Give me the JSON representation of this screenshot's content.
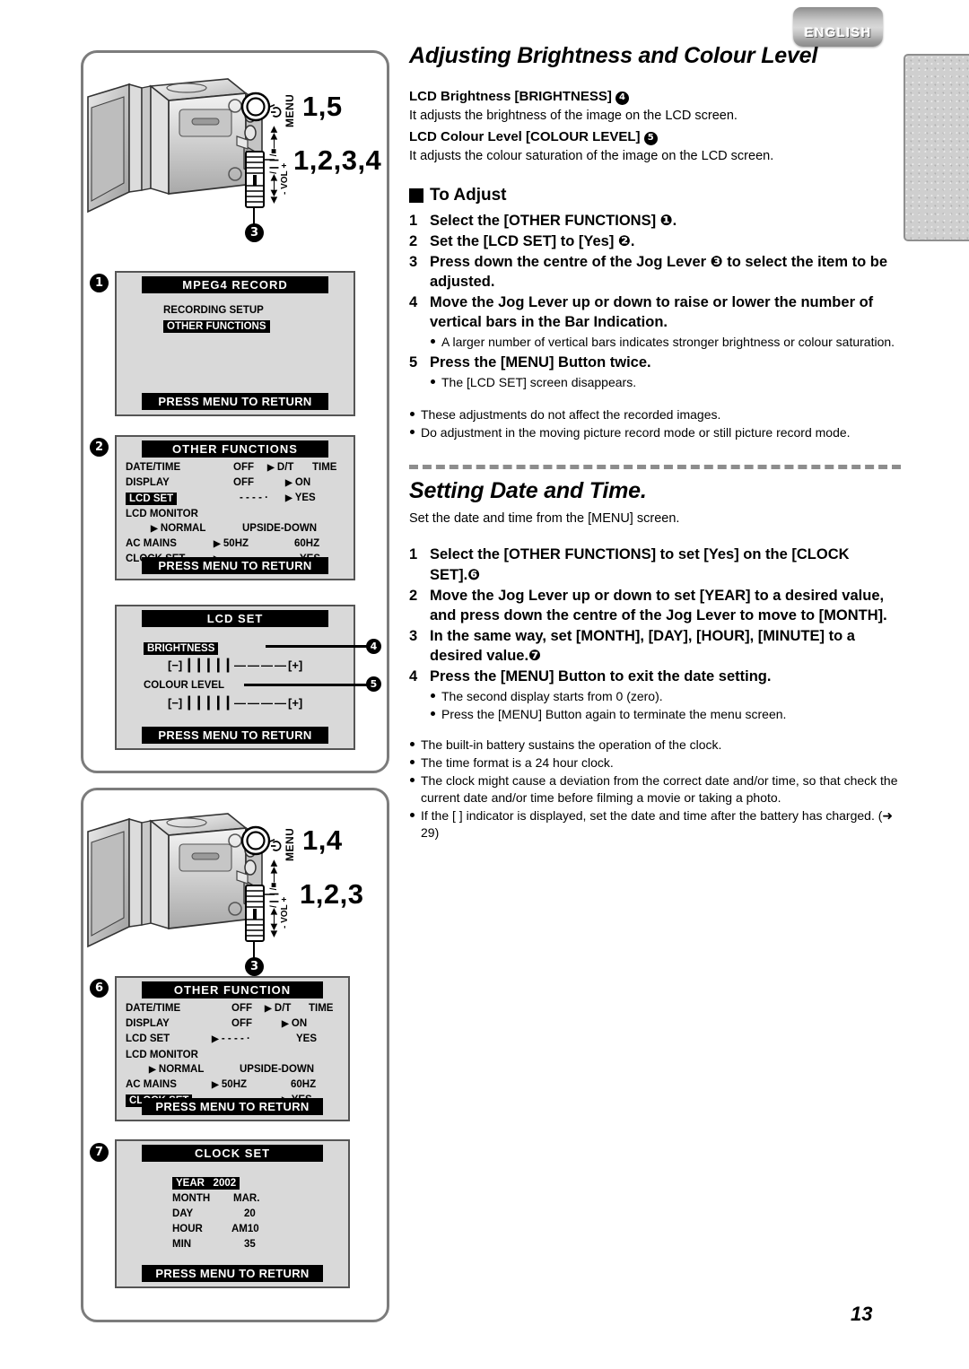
{
  "language_tab": "ENGLISH",
  "page_number": "13",
  "sections": [
    {
      "id": "brightness",
      "title": "Adjusting Brightness and Colour Level",
      "intro": [
        {
          "heading": "LCD Brightness [BRIGHTNESS]",
          "marker": "4",
          "text": "It adjusts the brightness of the image on the LCD screen."
        },
        {
          "heading": "LCD Colour Level [COLOUR LEVEL]",
          "marker": "5",
          "text": "It adjusts the colour saturation of the image on the LCD screen."
        }
      ],
      "block_heading": "To Adjust",
      "steps": [
        {
          "n": "1",
          "text": "Select the [OTHER FUNCTIONS] ❶."
        },
        {
          "n": "2",
          "text": "Set the [LCD SET] to [Yes] ❷."
        },
        {
          "n": "3",
          "text": "Press down the centre of the Jog Lever ❸ to select the item to be adjusted."
        },
        {
          "n": "4",
          "text": "Move the Jog Lever up or down to raise or lower the number of vertical bars in the Bar Indication.",
          "notes": [
            "A larger number of vertical bars indicates stronger brightness or colour saturation."
          ]
        },
        {
          "n": "5",
          "text": "Press the [MENU] Button twice.",
          "notes": [
            "The [LCD SET] screen disappears."
          ]
        }
      ],
      "footer_notes": [
        "These adjustments do not affect the recorded images.",
        "Do adjustment in the moving picture record mode or still picture record mode."
      ]
    },
    {
      "id": "clock",
      "title": "Setting Date and Time.",
      "lead": "Set the date and time from the [MENU] screen.",
      "steps": [
        {
          "n": "1",
          "text": "Select the [OTHER FUNCTIONS] to set [Yes] on the [CLOCK SET].❻"
        },
        {
          "n": "2",
          "text": "Move the Jog Lever up or down to set [YEAR] to a desired value, and press down the centre of the Jog Lever to move to [MONTH]."
        },
        {
          "n": "3",
          "text": "In the same way, set [MONTH], [DAY], [HOUR], [MINUTE] to a desired value.❼"
        },
        {
          "n": "4",
          "text": "Press the [MENU] Button to exit the date setting.",
          "notes": [
            "The second display starts from 0 (zero).",
            "Press the [MENU] Button again to terminate the menu screen."
          ]
        }
      ],
      "footer_notes": [
        "The built-in battery sustains the operation of the clock.",
        "The time format is a 24 hour clock.",
        "The clock might cause a deviation from the correct date and/or time, so that check the current date and/or time before filming a movie or taking a photo.",
        "If the [ ] indicator is displayed, set the date and time after the battery has charged. (➜ 29)"
      ]
    }
  ],
  "illustrations": [
    {
      "id": "camera-top",
      "menu_label": "MENU",
      "menu_steps": "1,5",
      "vol_label": "VOL",
      "vol_plus": "+",
      "vol_minus": "-",
      "jog_steps": "1,2,3,4",
      "jog_callout": "3"
    },
    {
      "id": "camera-bottom",
      "menu_label": "MENU",
      "menu_steps": "1,4",
      "vol_label": "VOL",
      "vol_plus": "+",
      "vol_minus": "-",
      "jog_steps": "1,2,3",
      "jog_callout": "3"
    }
  ],
  "lcd_screens": [
    {
      "callout": "1",
      "title": "MPEG4  RECORD",
      "footer": "PRESS MENU TO RETURN",
      "rows": [
        {
          "label": "RECORDING  SETUP",
          "highlight": false
        },
        {
          "label": "OTHER FUNCTIONS",
          "highlight": true
        }
      ]
    },
    {
      "callout": "2",
      "title": "OTHER  FUNCTIONS",
      "footer": "PRESS MENU TO RETURN",
      "menu": [
        {
          "label": "DATE/TIME",
          "highlight": false,
          "mid": "OFF",
          "mid_marker": false,
          "opt": "D/T",
          "opt_marker": true,
          "opt2": "TIME"
        },
        {
          "label": "DISPLAY",
          "highlight": false,
          "mid": "OFF",
          "mid_marker": false,
          "opt": "ON",
          "opt_marker": true
        },
        {
          "label": "LCD SET",
          "highlight": true,
          "mid": "- - - - ·",
          "mid_marker": false,
          "opt": "YES",
          "opt_marker": true
        },
        {
          "label": "LCD MONITOR",
          "highlight": false
        },
        {
          "label": "NORMAL",
          "indent": true,
          "marker": true,
          "opt2": "UPSIDE-DOWN"
        },
        {
          "label": "AC MAINS",
          "highlight": false,
          "mid": "50HZ",
          "mid_marker": true,
          "opt2": "60HZ"
        },
        {
          "label": "CLOCK SET",
          "highlight": false,
          "mid": "- - - - ·",
          "mid_marker": true,
          "opt2": "YES"
        }
      ]
    },
    {
      "callout": "",
      "title": "LCD SET",
      "footer": "PRESS MENU TO RETURN",
      "bars": [
        {
          "name": "BRIGHTNESS",
          "highlight": true,
          "minus": "[−]",
          "plus": "[+]",
          "filled": 5,
          "empty": 4,
          "marker": "4"
        },
        {
          "name": "COLOUR LEVEL",
          "highlight": false,
          "minus": "[−]",
          "plus": "[+]",
          "filled": 5,
          "empty": 4,
          "marker": "5"
        }
      ]
    },
    {
      "callout": "6",
      "title": "OTHER  FUNCTION",
      "footer": "PRESS MENU TO RETURN",
      "menu": [
        {
          "label": "DATE/TIME",
          "highlight": false,
          "mid": "OFF",
          "mid_marker": false,
          "opt": "D/T",
          "opt_marker": true,
          "opt2": "TIME"
        },
        {
          "label": "DISPLAY",
          "highlight": false,
          "mid": "OFF",
          "mid_marker": false,
          "opt": "ON",
          "opt_marker": true
        },
        {
          "label": "LCD SET",
          "highlight": false,
          "mid": "- - - - ·",
          "mid_marker": true,
          "opt2": "YES"
        },
        {
          "label": "LCD MONITOR",
          "highlight": false
        },
        {
          "label": "NORMAL",
          "indent": true,
          "marker": true,
          "opt2": "UPSIDE-DOWN"
        },
        {
          "label": "AC MAINS",
          "highlight": false,
          "mid": "50HZ",
          "mid_marker": true,
          "opt2": "60HZ"
        },
        {
          "label": "CLOCK SET",
          "highlight": true,
          "mid": "- - - - ·",
          "mid_marker": false,
          "opt": "YES",
          "opt_marker": true
        }
      ]
    },
    {
      "callout": "7",
      "title": "CLOCK  SET",
      "footer": "PRESS MENU TO RETURN",
      "clock": [
        {
          "label": "YEAR",
          "value": "2002",
          "highlight": true
        },
        {
          "label": "MONTH",
          "value": "MAR.",
          "highlight": false
        },
        {
          "label": "DAY",
          "value": "20",
          "highlight": false
        },
        {
          "label": "HOUR",
          "value": "AM10",
          "highlight": false
        },
        {
          "label": "MIN",
          "value": "35",
          "highlight": false
        }
      ]
    }
  ]
}
